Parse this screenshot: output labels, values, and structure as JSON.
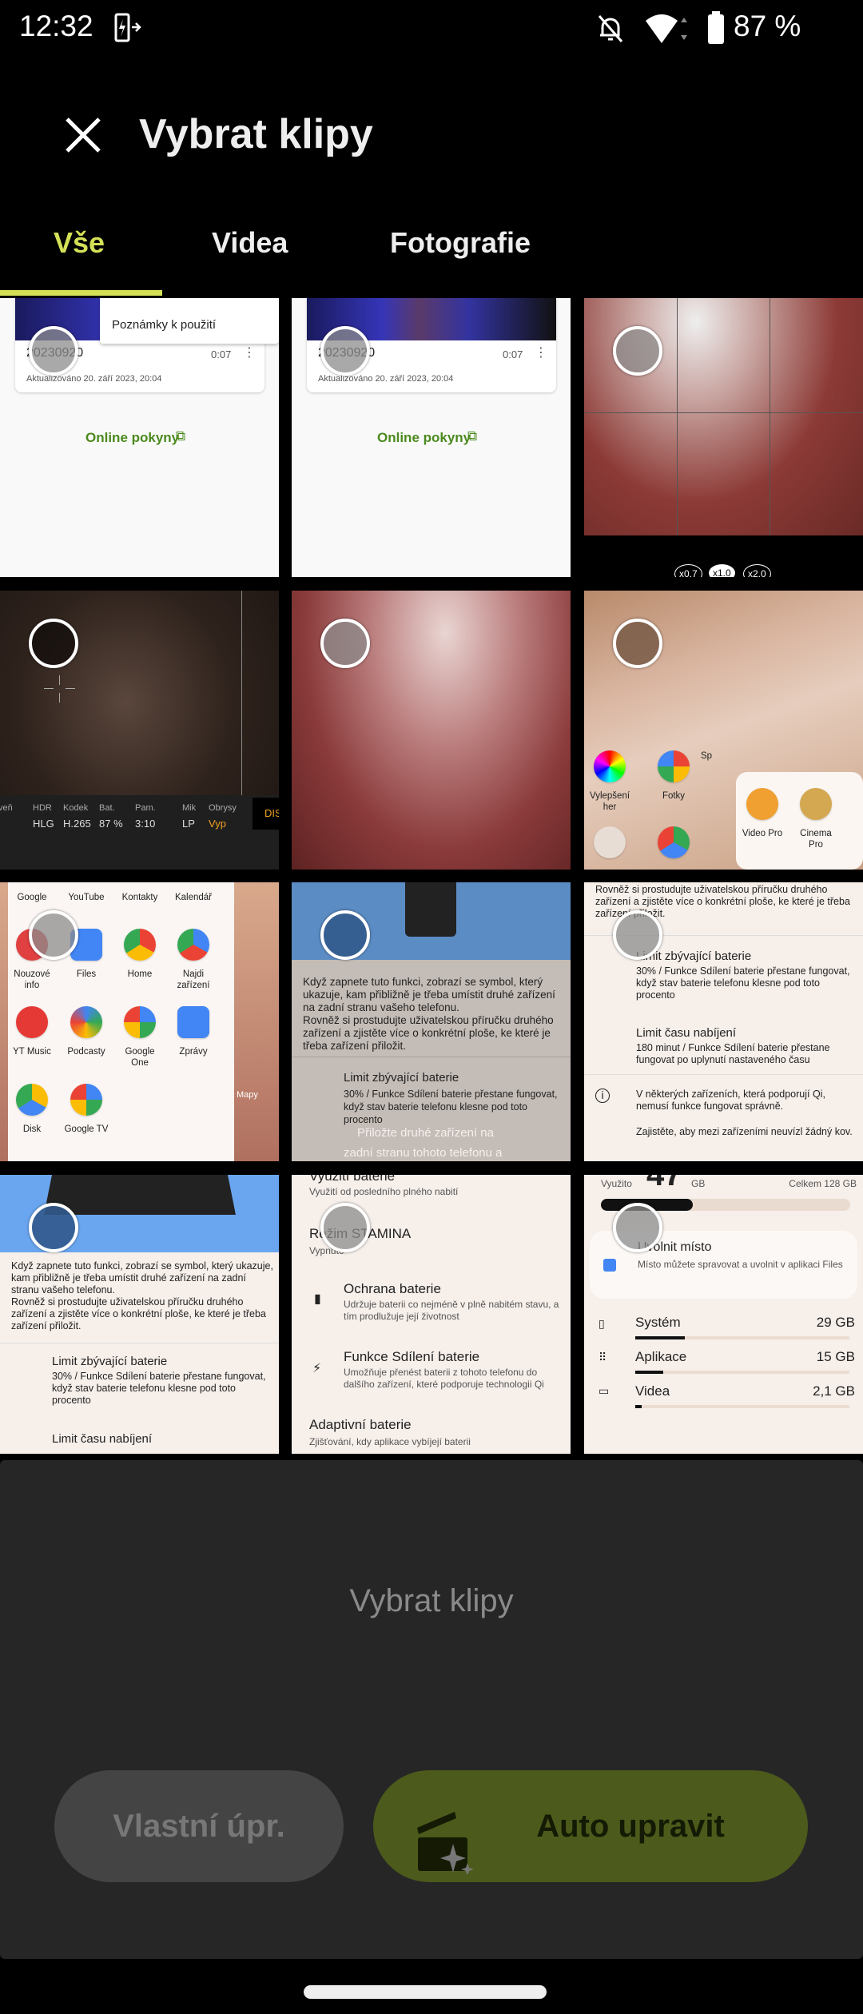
{
  "status_bar": {
    "time": "12:32",
    "battery": "87 %",
    "icons": [
      "battery-share-icon",
      "bell-off-icon",
      "wifi-icon",
      "battery-icon"
    ]
  },
  "header": {
    "title": "Vybrat klipy",
    "close_icon": "close-icon"
  },
  "tabs": [
    {
      "label": "Vše",
      "active": true
    },
    {
      "label": "Videa"
    },
    {
      "label": "Fotografie"
    }
  ],
  "colors": {
    "accent": "#d4e157",
    "panel": "#262626",
    "auto_button": "#4c5a1b"
  },
  "tiles": {
    "t1": {
      "name": "20230920",
      "duration": "0:07",
      "updated": "Aktualizováno 20. září 2023, 20:04",
      "menu": "Poznámky k použití",
      "link": "Online pokyny"
    },
    "t2": {
      "name": "20230920",
      "duration": "0:07",
      "updated": "Aktualizováno 20. září 2023, 20:04",
      "link": "Online pokyny"
    },
    "t3": {
      "zoom": [
        "x0.7",
        "x1.0",
        "x2.0"
      ]
    },
    "t4": {
      "labels": [
        "veň",
        "HDR",
        "Kodek",
        "Bat.",
        "Pam.",
        "Mik",
        "Obrysy"
      ],
      "values": [
        "",
        "HLG",
        "H.265",
        "87 %",
        "3:10",
        "LP",
        "Vyp"
      ],
      "dis": "DIS"
    },
    "t6": {
      "apps": [
        "Vylepšení her",
        "Fotky",
        "Sp",
        "Video Pro",
        "Cinema Pro"
      ]
    },
    "t7": {
      "apps": [
        "Google",
        "YouTube",
        "Kontakty",
        "Kalendář",
        "Nouzové info",
        "Files",
        "Home",
        "Najdi zařízení",
        "YT Music",
        "Podcasty",
        "Google One",
        "Zprávy",
        "Disk",
        "Google TV"
      ],
      "side": "Mapy"
    },
    "t8": {
      "p1": "Když zapnete tuto funkci, zobrazí se symbol, který ukazuje, kam přibližně je třeba umístit druhé zařízení na zadní stranu vašeho telefonu.",
      "p2": "Rovněž si prostudujte uživatelskou příručku druhého zařízení a zjistěte více o konkrétní ploše, ke které je třeba zařízení přiložit.",
      "h": "Limit zbývající baterie",
      "d": "30% / Funkce Sdílení baterie přestane fungovat, když stav baterie telefonu klesne pod toto procento",
      "overlay1": "Přiložte druhé zařízení na",
      "overlay2": "zadní stranu tohoto telefonu a"
    },
    "t9": {
      "p": "Rovněž si prostudujte uživatelskou příručku druhého zařízení a zjistěte více o konkrétní ploše, ke které je třeba zařízení přiložit.",
      "h1": "Limit zbývající baterie",
      "d1": "30% / Funkce Sdílení baterie přestane fungovat, když stav baterie telefonu klesne pod toto procento",
      "h2": "Limit času nabíjení",
      "d2": "180 minut / Funkce Sdílení baterie přestane fungovat po uplynutí nastaveného času",
      "i1": "V některých zařízeních, která podporují Qi, nemusí funkce fungovat správně.",
      "i2": "Zajistěte, aby mezi zařízeními neuvízl žádný kov."
    },
    "t10": {
      "p1": "Když zapnete tuto funkci, zobrazí se symbol, který ukazuje, kam přibližně je třeba umístit druhé zařízení na zadní stranu vašeho telefonu.",
      "p2": "Rovněž si prostudujte uživatelskou příručku druhého zařízení a zjistěte více o konkrétní ploše, ke které je třeba zařízení přiložit.",
      "h1": "Limit zbývající baterie",
      "d1": "30% / Funkce Sdílení baterie přestane fungovat, když stav baterie telefonu klesne pod toto procento",
      "h2": "Limit času nabíjení"
    },
    "t11": {
      "h0": "Využití baterie",
      "d0": "Využití od posledního plného nabití",
      "h1": "Režim STAMINA",
      "d1": "Vypnuto",
      "h2": "Ochrana baterie",
      "d2": "Udržuje baterii co nejméně v plně nabitém stavu, a tím prodlužuje její životnost",
      "h3": "Funkce Sdílení baterie",
      "d3": "Umožňuje přenést baterii z tohoto telefonu do dalšího zařízení, které podporuje technologii Qi",
      "h4": "Adaptivní baterie",
      "d4": "Zjišťování, kdy aplikace vybíjejí baterii"
    },
    "t12": {
      "used_label": "Využito",
      "used": "47",
      "unit": "GB",
      "total": "Celkem 128 GB",
      "used_fraction": 0.37,
      "free_h": "Uvolnit místo",
      "free_d": "Místo můžete spravovat a uvolnit v aplikaci Files",
      "rows": [
        {
          "label": "Systém",
          "size": "29 GB",
          "fraction": 0.23
        },
        {
          "label": "Aplikace",
          "size": "15 GB",
          "fraction": 0.13
        },
        {
          "label": "Videa",
          "size": "2,1 GB",
          "fraction": 0.03
        }
      ]
    }
  },
  "panel": {
    "hint": "Vybrat klipy",
    "custom_button": "Vlastní úpr.",
    "auto_button": "Auto upravit"
  }
}
